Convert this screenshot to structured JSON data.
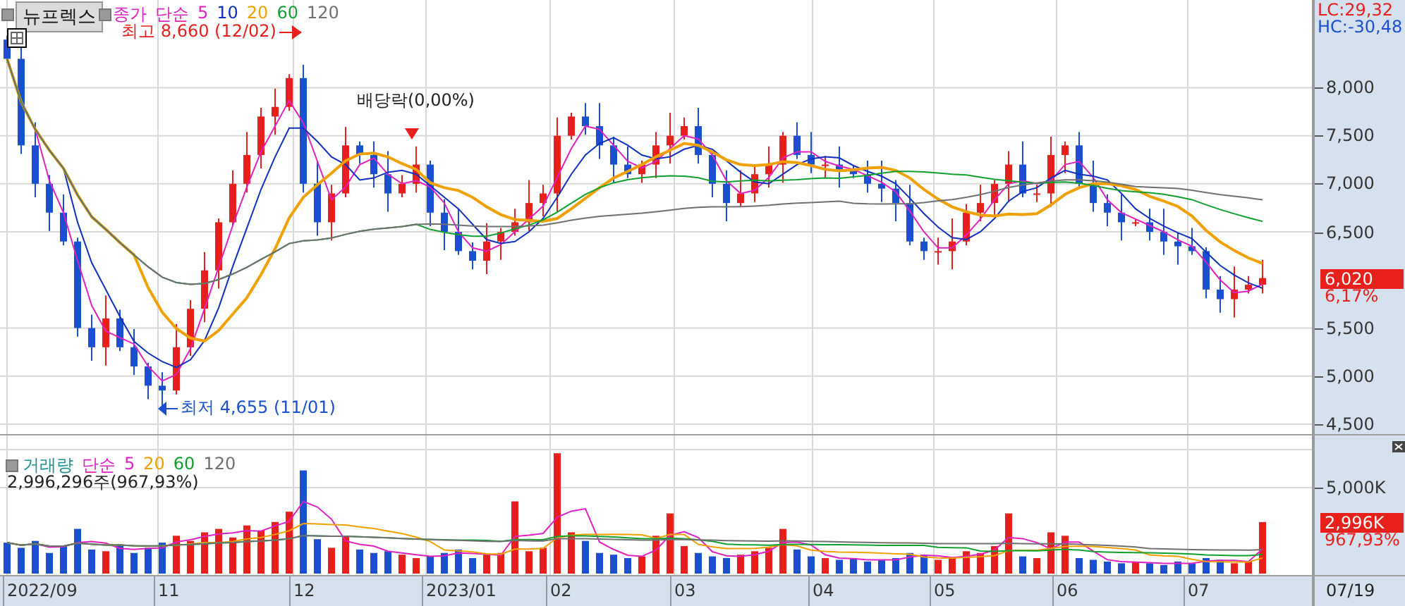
{
  "price_pane": {
    "stock_name": "뉴프렉스",
    "series_name": "종가",
    "legend_label": "단순",
    "periods": [
      {
        "text": "5",
        "color": "#e020c0"
      },
      {
        "text": "10",
        "color": "#1030c0"
      },
      {
        "text": "20",
        "color": "#f0a000"
      },
      {
        "text": "60",
        "color": "#10a030"
      },
      {
        "text": "120",
        "color": "#707070"
      }
    ],
    "high_note": "최고 8,660 (12/02)",
    "low_note": "최저 4,655 (11/01)",
    "dividend_note": "배당락(0,00%)",
    "lc": "LC:29,32",
    "hc": "HC:-30,48",
    "price_tag": "6,020",
    "change_tag": "6,17%",
    "tick_labels": [
      "8,000",
      "7,500",
      "7,000",
      "6,500",
      "5,500",
      "5,000",
      "4,500"
    ]
  },
  "volume_pane": {
    "legend_label": "거래량",
    "legend_kind": "단순",
    "periods": [
      {
        "text": "5",
        "color": "#e020c0"
      },
      {
        "text": "20",
        "color": "#f0a000"
      },
      {
        "text": "60",
        "color": "#10a030"
      },
      {
        "text": "120",
        "color": "#707070"
      }
    ],
    "info": "2,996,296주(967,93%)",
    "volume_tag": "2,996K",
    "change_tag": "967,93%",
    "volume_tick": "5,000K"
  },
  "date_labels": [
    "2022/09",
    "11",
    "12",
    "2023/01",
    "02",
    "03",
    "04",
    "05",
    "06",
    "07"
  ],
  "date_tag": "07/19"
}
